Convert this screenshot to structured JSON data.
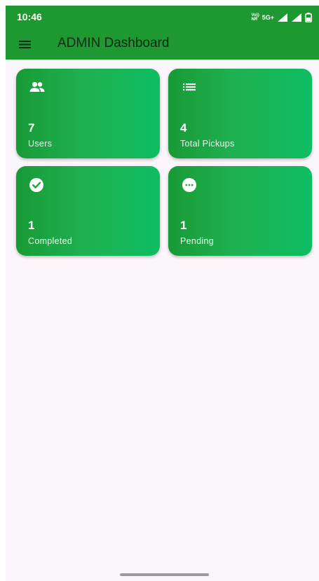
{
  "status_bar": {
    "time": "10:46",
    "volte_top": "Vo))",
    "volte_bottom": "NR",
    "network": "5G+"
  },
  "app_bar": {
    "title": "ADMIN Dashboard",
    "menu_icon": "hamburger-menu-icon"
  },
  "cards": [
    {
      "icon": "users-icon",
      "value": "7",
      "label": "Users"
    },
    {
      "icon": "list-icon",
      "value": "4",
      "label": "Total Pickups"
    },
    {
      "icon": "check-circle-icon",
      "value": "1",
      "label": "Completed"
    },
    {
      "icon": "more-horizontal-circle-icon",
      "value": "1",
      "label": "Pending"
    }
  ],
  "colors": {
    "primary": "#1e9830",
    "card_gradient_start": "#189a36",
    "card_gradient_end": "#0ebd62",
    "background": "#fbf6fc"
  }
}
